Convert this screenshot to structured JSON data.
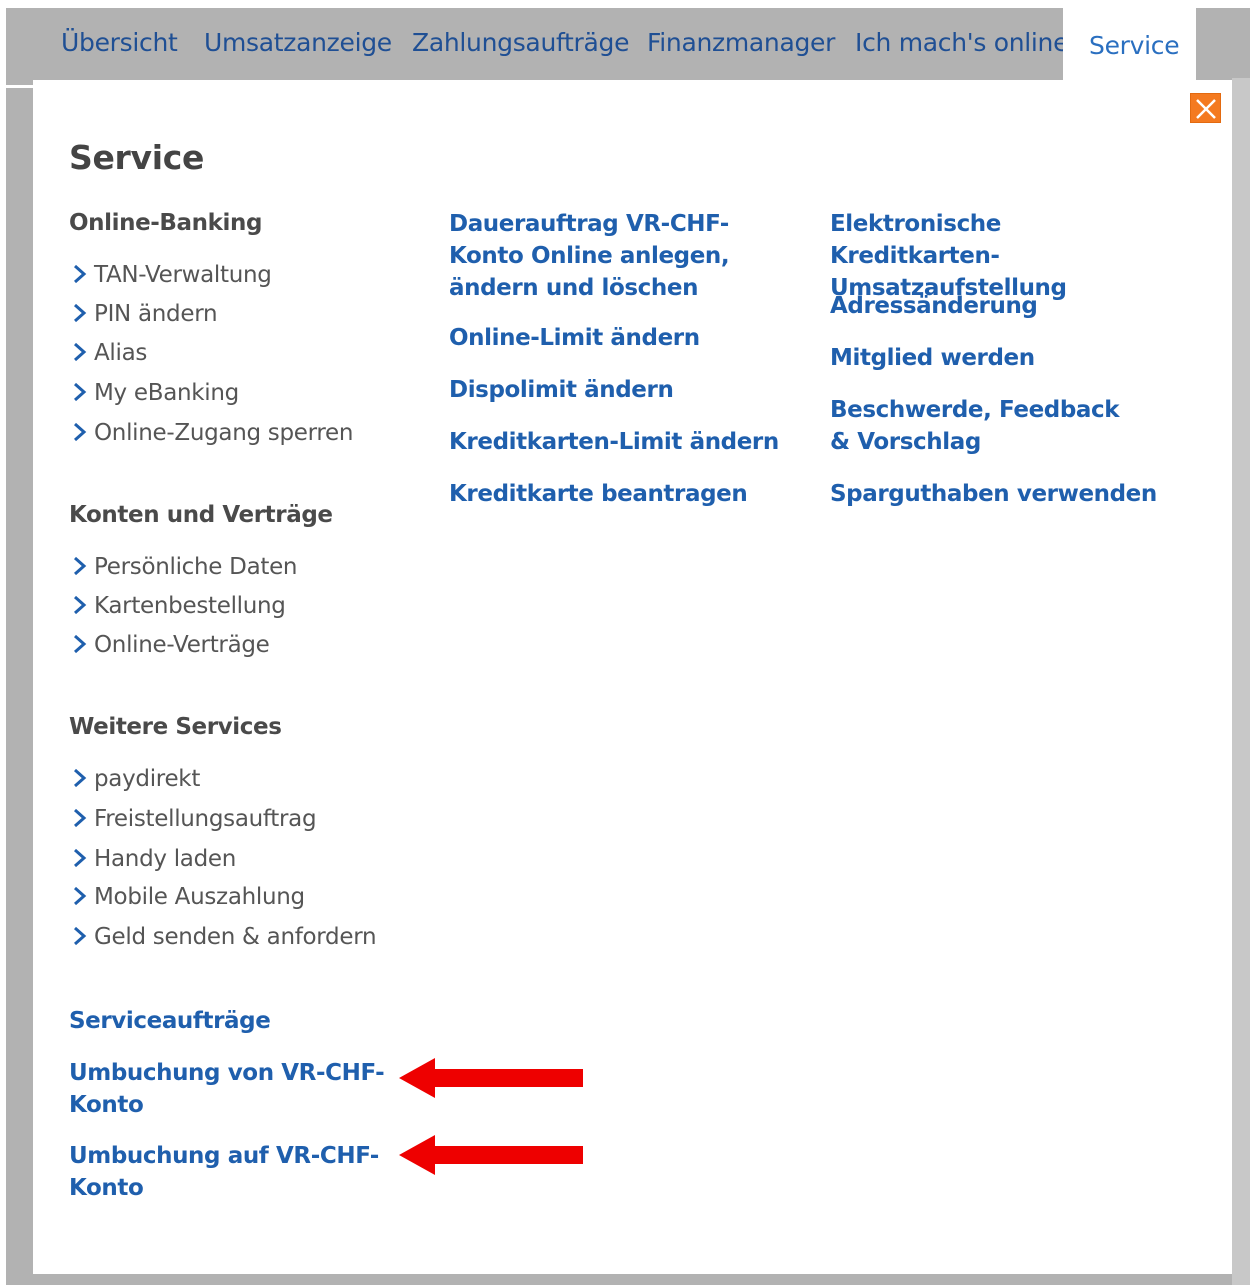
{
  "nav": {
    "tabs": [
      {
        "label": "Übersicht"
      },
      {
        "label": "Umsatzanzeige"
      },
      {
        "label": "Zahlungsaufträge"
      },
      {
        "label": "Finanzmanager"
      },
      {
        "label": "Ich mach's online"
      },
      {
        "label": "Service"
      }
    ],
    "active": "Service"
  },
  "panel": {
    "title": "Service",
    "close_icon": "close-icon",
    "sections": [
      {
        "heading": "Online-Banking",
        "items": [
          "TAN-Verwaltung",
          "PIN ändern",
          "Alias",
          "My eBanking",
          "Online-Zugang sperren"
        ]
      },
      {
        "heading": "Konten und Verträge",
        "items": [
          "Persönliche Daten",
          "Kartenbestellung",
          "Online-Verträge"
        ]
      },
      {
        "heading": "Weitere Services",
        "items": [
          "paydirekt",
          "Freistellungsauftrag",
          "Handy laden",
          "Mobile Auszahlung",
          "Geld senden & anfordern"
        ]
      }
    ],
    "service_orders": {
      "heading": "Serviceaufträge",
      "links": [
        "Umbuchung von VR-CHF-\nKonto",
        "Umbuchung auf VR-CHF-\nKonto"
      ]
    },
    "column2": [
      "Dauerauftrag VR-CHF-Konto Online anlegen, ändern und löschen",
      "Online-Limit ändern",
      "Dispolimit ändern",
      "Kreditkarten-Limit ändern",
      "Kreditkarte beantragen"
    ],
    "column3": [
      "Elektronische Kreditkarten-Umsatzaufstellung",
      "Adressänderung",
      "Mitglied werden",
      "Beschwerde, Feedback & Vorschlag",
      "Sparguthaben verwenden"
    ]
  },
  "colors": {
    "nav_text": "#1f4f94",
    "link": "#1f5fad",
    "close_button": "#f47a20",
    "arrow": "#ee0000"
  }
}
